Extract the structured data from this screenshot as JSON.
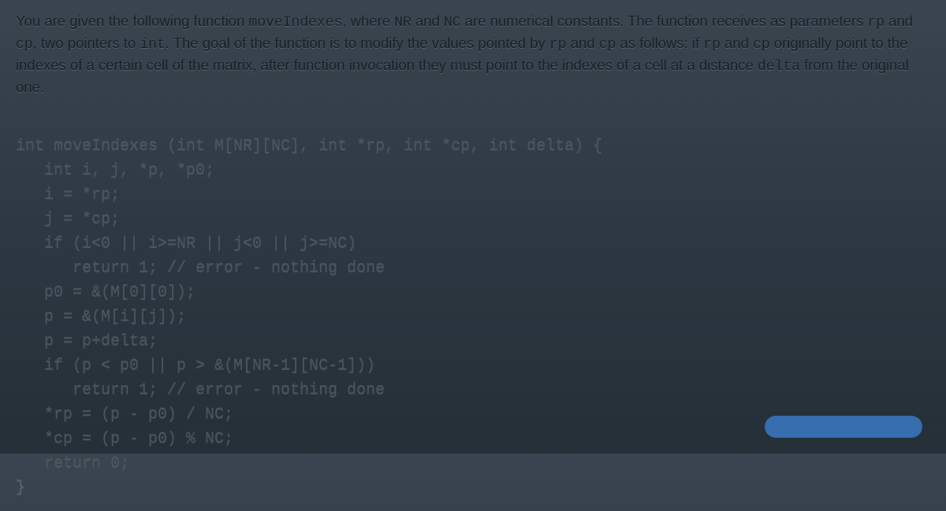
{
  "description": {
    "part1": "You are given the following function ",
    "func": "moveIndexes",
    "part2": ", where ",
    "nr": "NR",
    "part3": " and ",
    "nc": "NC",
    "part4": " are numerical constants. The function receives as parameters ",
    "rp": "rp",
    "part5": " and ",
    "cp": "cp",
    "part6": ", two pointers to ",
    "int": "int",
    "part7": ". The goal of the function is to modify the values pointed by ",
    "part8": " as follows: if ",
    "part9": " originally point to the indexes of a certain cell of the matrix, after function invocation they must point to the indexes of a cell at a distance ",
    "delta": "delta",
    "part10": " from the original one."
  },
  "code": {
    "l1": "int moveIndexes (int M[NR][NC], int *rp, int *cp, int delta) {",
    "l2": "   int i, j, *p, *p0;",
    "l3": "   i = *rp;",
    "l4": "   j = *cp;",
    "l5": "   if (i<0 || i>=NR || j<0 || j>=NC)",
    "l6": "      return 1; // error - nothing done",
    "l7": "   p0 = &(M[0][0]);",
    "l8": "   p = &(M[i][j]);",
    "l9": "   p = p+delta;",
    "l10": "   if (p < p0 || p > &(M[NR-1][NC-1]))",
    "l11": "      return 1; // error - nothing done",
    "l12": "   *rp = (p - p0) / NC;",
    "l13": "   *cp = (p - p0) % NC;",
    "l14": "   return 0;",
    "l15": "}"
  },
  "edge": "no"
}
